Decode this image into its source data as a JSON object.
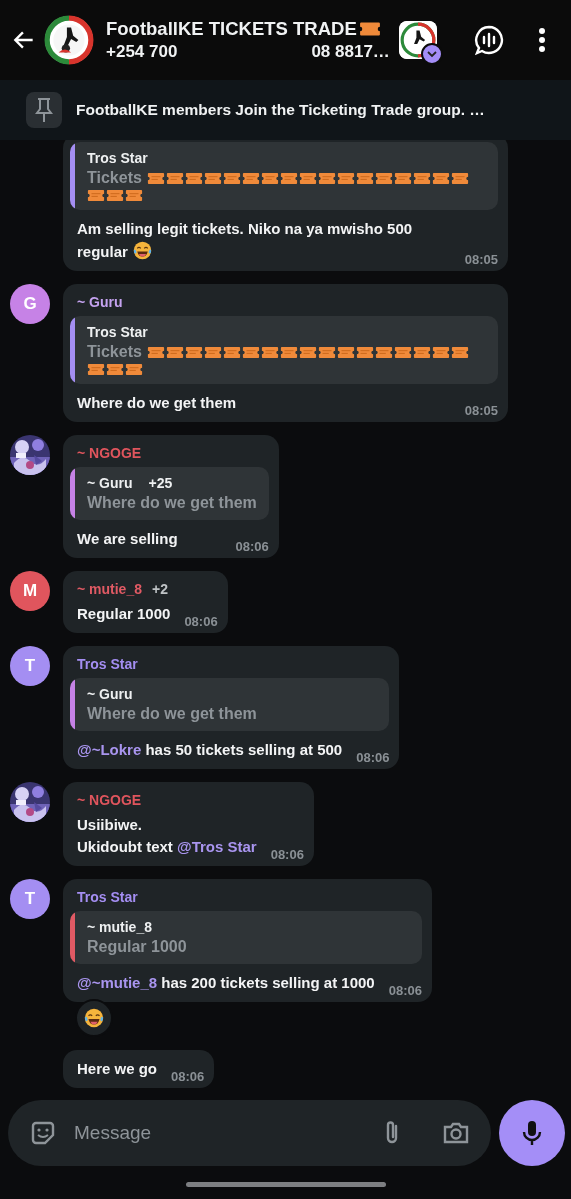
{
  "header": {
    "title": "FootballKE TICKETS TRADE",
    "subtitle_start": "+254 700",
    "subtitle_end": "08 8817…"
  },
  "pinned": {
    "text": "FootballKE members Join the Ticketing Trade group. …"
  },
  "messages": [
    {
      "quote": {
        "sender": "Tros Star",
        "text": "Tickets",
        "tickets": true,
        "color": "#a48ef2"
      },
      "lines": [
        [
          {
            "kind": "text",
            "text": "Am selling legit tickets. Niko na ya mwisho 500 regular "
          },
          {
            "kind": "laugh"
          }
        ]
      ],
      "time": "08:05"
    },
    {
      "avatar": {
        "kind": "letter",
        "letter": "G",
        "color": "#c682e6"
      },
      "sender": {
        "name": "~ Guru",
        "color": "#c5a3f0"
      },
      "quote": {
        "sender": "Tros Star",
        "text": "Tickets",
        "tickets": true,
        "color": "#a48ef2"
      },
      "lines": [
        [
          {
            "kind": "text",
            "text": "Where do we get them"
          }
        ]
      ],
      "time": "08:05"
    },
    {
      "avatar": {
        "kind": "picture"
      },
      "sender": {
        "name": "~ NGOGE",
        "color": "#e0555d"
      },
      "quote": {
        "sender": "~ Guru",
        "extra": "+25",
        "text": "Where do we get them",
        "color": "#c682e6"
      },
      "lines": [
        [
          {
            "kind": "text",
            "text": "We are selling"
          }
        ]
      ],
      "time": "08:06"
    },
    {
      "avatar": {
        "kind": "letter",
        "letter": "M",
        "color": "#e0555d"
      },
      "sender": {
        "name": "~ mutie_8",
        "extra": "+2",
        "color": "#e05a64"
      },
      "lines": [
        [
          {
            "kind": "text",
            "text": "Regular 1000"
          }
        ]
      ],
      "time": "08:06"
    },
    {
      "avatar": {
        "kind": "letter",
        "letter": "T",
        "color": "#a48ef2"
      },
      "sender": {
        "name": "Tros Star",
        "color": "#a48ef2"
      },
      "quote": {
        "sender": "~ Guru",
        "text": "Where do we get them",
        "color": "#c682e6"
      },
      "lines": [
        [
          {
            "kind": "mention",
            "text": "@~Lokre"
          },
          {
            "kind": "text",
            "text": " has 50 tickets selling at 500"
          }
        ]
      ],
      "time": "08:06"
    },
    {
      "avatar": {
        "kind": "picture"
      },
      "sender": {
        "name": "~ NGOGE",
        "color": "#e0555d"
      },
      "lines": [
        [
          {
            "kind": "text",
            "text": "Usiibiwe."
          }
        ],
        [
          {
            "kind": "text",
            "text": "Ukidoubt text "
          },
          {
            "kind": "mention",
            "text": "@Tros Star"
          }
        ]
      ],
      "time": "08:06"
    },
    {
      "avatar": {
        "kind": "letter",
        "letter": "T",
        "color": "#a48ef2"
      },
      "sender": {
        "name": "Tros Star",
        "color": "#a48ef2"
      },
      "quote": {
        "sender": "~ mutie_8",
        "text": "Regular 1000",
        "color": "#e05a64"
      },
      "lines": [
        [
          {
            "kind": "mention",
            "text": "@~mutie_8"
          },
          {
            "kind": "text",
            "text": " has 200 tickets selling at 1000"
          }
        ]
      ],
      "time": "08:06",
      "reaction": {
        "kind": "laugh"
      }
    },
    {
      "lines": [
        [
          {
            "kind": "text",
            "text": "Here we go"
          }
        ]
      ],
      "time": "08:06"
    }
  ],
  "composer": {
    "placeholder": "Message"
  }
}
